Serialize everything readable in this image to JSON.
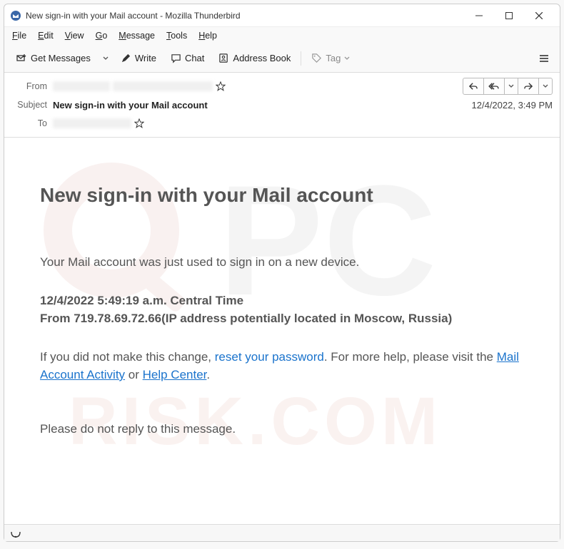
{
  "window": {
    "title": "New sign-in with your Mail account - Mozilla Thunderbird"
  },
  "menubar": {
    "file": "File",
    "edit": "Edit",
    "view": "View",
    "go": "Go",
    "message": "Message",
    "tools": "Tools",
    "help": "Help"
  },
  "toolbar": {
    "get_messages": "Get Messages",
    "write": "Write",
    "chat": "Chat",
    "address_book": "Address Book",
    "tag": "Tag"
  },
  "headers": {
    "from_label": "From",
    "subject_label": "Subject",
    "to_label": "To",
    "subject": "New sign-in with your Mail account",
    "date": "12/4/2022, 3:49 PM"
  },
  "message": {
    "heading": "New sign-in with your Mail account",
    "intro": "Your Mail account was just used to sign in on a new device.",
    "timestamp": "12/4/2022 5:49:19 a.m. Central Time",
    "from_line": "From 719.78.69.72.66(IP address potentially located in Moscow, Russia)",
    "help_prefix": "If you did not make this change, ",
    "reset_link": "reset your password",
    "help_mid": ". For more help, please visit the ",
    "activity_link": "Mail Account Activity",
    "or_text": " or ",
    "help_center_link": "Help Center",
    "period": ".",
    "footer": "Please do not reply to this message."
  }
}
